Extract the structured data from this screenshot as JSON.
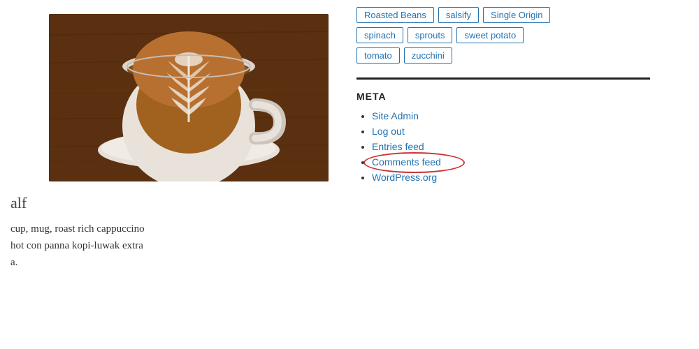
{
  "left": {
    "half_label": "alf",
    "body_text_line1": "cup, mug, roast rich cappuccino",
    "body_text_line2": "hot con panna kopi-luwak extra",
    "body_text_line3": "a."
  },
  "right": {
    "tags": [
      [
        "Roasted Beans",
        "salsify",
        "Single Origin"
      ],
      [
        "spinach",
        "sprouts",
        "sweet potato"
      ],
      [
        "tomato",
        "zucchini"
      ]
    ],
    "meta_heading": "META",
    "meta_links": [
      {
        "label": "Site Admin",
        "href": "#"
      },
      {
        "label": "Log out",
        "href": "#"
      },
      {
        "label": "Entries feed",
        "href": "#"
      },
      {
        "label": "Comments feed",
        "href": "#"
      },
      {
        "label": "WordPress.org",
        "href": "#"
      }
    ]
  }
}
